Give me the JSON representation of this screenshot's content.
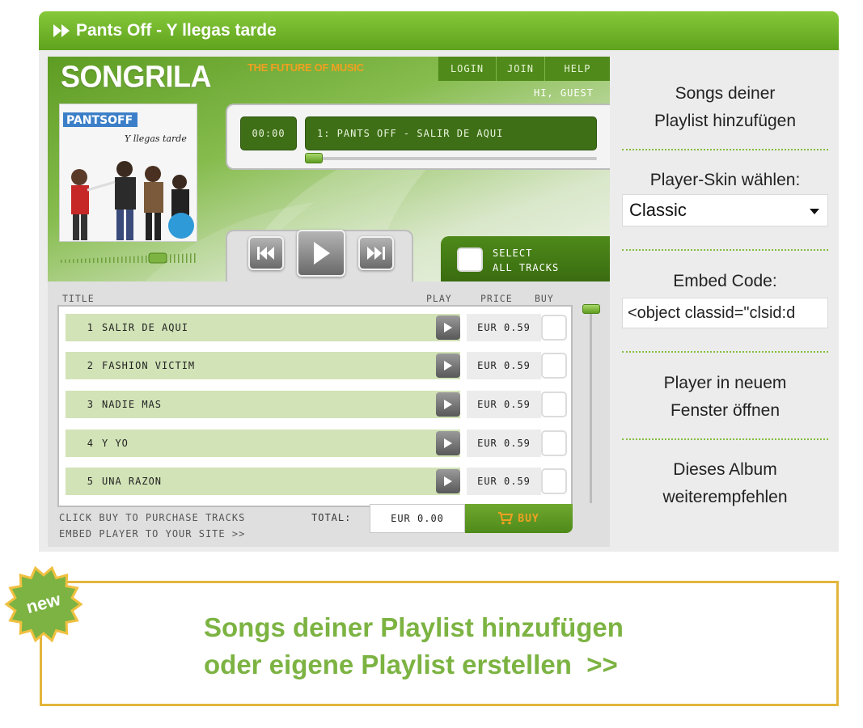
{
  "window": {
    "title": "Pants Off - Y llegas tarde"
  },
  "player": {
    "logo": "SONGRILA",
    "tagline": "THE FUTURE OF MUSIC",
    "nav": [
      "LOGIN",
      "JOIN",
      "HELP"
    ],
    "greeting": "HI, GUEST",
    "time": "00:00",
    "now_playing": "1: PANTS OFF - SALIR DE AQUI",
    "album_cover": {
      "band": "PANTSOFF",
      "album": "Y llegas tarde"
    },
    "select_all_label": "SELECT\nALL TRACKS",
    "columns": {
      "title": "TITLE",
      "play": "PLAY",
      "price": "PRICE",
      "buy": "BUY"
    },
    "tracks": [
      {
        "num": "1",
        "title": "SALIR DE AQUI",
        "price": "EUR 0.59"
      },
      {
        "num": "2",
        "title": "FASHION VICTIM",
        "price": "EUR 0.59"
      },
      {
        "num": "3",
        "title": "NADIE MAS",
        "price": "EUR 0.59"
      },
      {
        "num": "4",
        "title": "Y YO",
        "price": "EUR 0.59"
      },
      {
        "num": "5",
        "title": "UNA RAZON",
        "price": "EUR 0.59"
      }
    ],
    "footer_buy_hint": "CLICK BUY TO PURCHASE TRACKS",
    "footer_embed_link": "EMBED PLAYER TO YOUR SITE >>",
    "total_label": "TOTAL:",
    "total_value": "EUR 0.00",
    "buy_label": "BUY",
    "progress_fraction": 0.0,
    "volume_fraction": 0.75
  },
  "sidebar": {
    "add_to_playlist": "Songs deiner\nPlaylist hinzufügen",
    "skin_label": "Player-Skin wählen:",
    "skin_value": "Classic",
    "embed_label": "Embed Code:",
    "embed_value": "<object classid=\"clsid:d",
    "new_window": "Player in neuem\nFenster öffnen",
    "recommend": "Dieses Album\nweiterempfehlen"
  },
  "promo": {
    "badge": "new",
    "text": "Songs deiner Playlist hinzufügen\noder eigene Playlist erstellen  >>"
  },
  "colors": {
    "brand_green": "#5fa31d",
    "accent_orange": "#f0a020",
    "promo_border": "#e3b53a",
    "promo_text": "#7cb342"
  }
}
